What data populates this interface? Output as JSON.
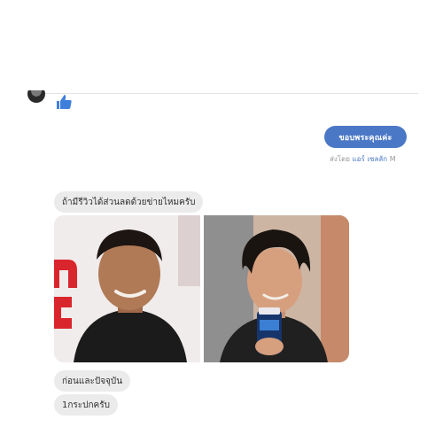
{
  "conversation": {
    "thumbs_up_icon": "thumbs-up-icon",
    "sent": {
      "text": "ขอบพระคุณค่ะ",
      "meta_prefix": "ส่งโดย",
      "meta_name": "แอร์ เซลลัก",
      "meta_suffix": "M"
    },
    "received": [
      {
        "text": "ถ้ามีรีวิวได้ส่วนลดด้วยข่ายไหมครับ"
      },
      {
        "text": "ก่อนและปัจจุบัน"
      },
      {
        "text": "1กระปกครับ"
      }
    ],
    "photos": {
      "before_bg": "#f1ecec",
      "after_bg": "#cdb5a4",
      "accent_red": "#d9262c",
      "bubble_blue": "#4a78c6"
    }
  }
}
